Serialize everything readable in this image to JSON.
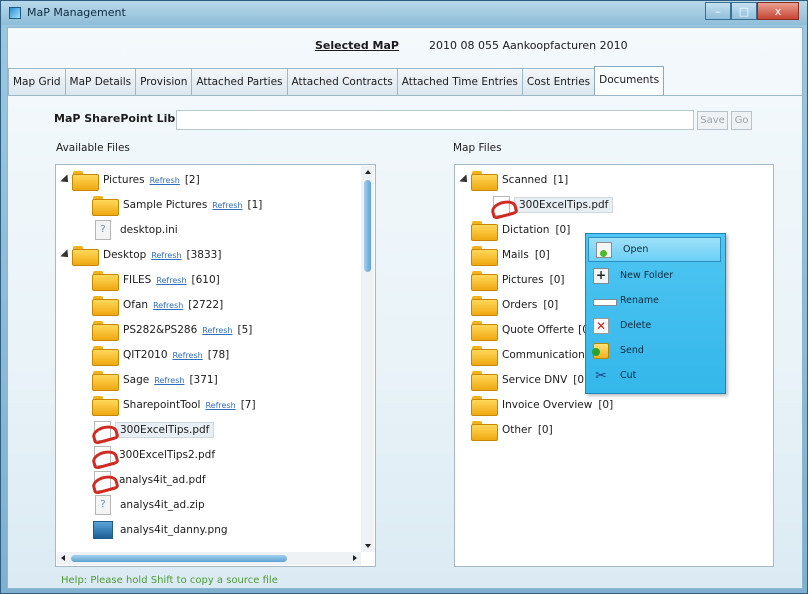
{
  "window": {
    "title": "MaP Management",
    "buttons": {
      "minimize": "–",
      "maximize": "□",
      "close": "x"
    }
  },
  "header": {
    "selected_label": "Selected MaP",
    "selected_value": "2010 08 055 Aankoopfacturen 2010"
  },
  "tabs": [
    {
      "label": "Map Grid"
    },
    {
      "label": "MaP Details"
    },
    {
      "label": "Provision"
    },
    {
      "label": "Attached Parties"
    },
    {
      "label": "Attached Contracts"
    },
    {
      "label": "Attached Time Entries"
    },
    {
      "label": "Cost Entries"
    },
    {
      "label": "Documents"
    }
  ],
  "active_tab": "Documents",
  "library": {
    "label": "MaP SharePoint Library",
    "value": "",
    "save_label": "Save",
    "go_label": "Go"
  },
  "available": {
    "label": "Available Files",
    "refresh_label": "Refresh",
    "rows": [
      {
        "name": "Pictures",
        "count": "[2]",
        "icon": "folder-icon"
      },
      {
        "name": "Sample Pictures",
        "count": "[1]",
        "icon": "folder-icon"
      },
      {
        "name": "desktop.ini",
        "icon": "unknown-file-icon"
      },
      {
        "name": "Desktop",
        "count": "[3833]",
        "icon": "folder-icon"
      },
      {
        "name": "FILES",
        "count": "[610]",
        "icon": "folder-icon"
      },
      {
        "name": "Ofan",
        "count": "[2722]",
        "icon": "folder-icon"
      },
      {
        "name": "PS282&PS286",
        "count": "[5]",
        "icon": "folder-icon"
      },
      {
        "name": "QIT2010",
        "count": "[78]",
        "icon": "folder-icon"
      },
      {
        "name": "Sage",
        "count": "[371]",
        "icon": "folder-icon"
      },
      {
        "name": "SharepointTool",
        "count": "[7]",
        "icon": "folder-icon"
      },
      {
        "name": "300ExcelTips.pdf",
        "icon": "pdf-icon"
      },
      {
        "name": "300ExcelTips2.pdf",
        "icon": "pdf-icon"
      },
      {
        "name": "analys4it_ad.pdf",
        "icon": "pdf-icon"
      },
      {
        "name": "analys4it_ad.zip",
        "icon": "unknown-file-icon"
      },
      {
        "name": "analys4it_danny.png",
        "icon": "image-icon"
      }
    ]
  },
  "mapfiles": {
    "label": "Map Files",
    "rows": [
      {
        "name": "Scanned",
        "count": "[1]",
        "icon": "folder-icon"
      },
      {
        "name": "300ExcelTips.pdf",
        "icon": "pdf-icon"
      },
      {
        "name": "Dictation",
        "count": "[0]",
        "icon": "folder-icon"
      },
      {
        "name": "Mails",
        "count": "[0]",
        "icon": "folder-icon"
      },
      {
        "name": "Pictures",
        "count": "[0]",
        "icon": "folder-icon"
      },
      {
        "name": "Orders",
        "count": "[0]",
        "icon": "folder-icon"
      },
      {
        "name": "Quote Offerte",
        "count": "[0",
        "icon": "folder-icon"
      },
      {
        "name": "Communication",
        "count": "",
        "icon": "folder-icon"
      },
      {
        "name": "Service DNV",
        "count": "[0]",
        "icon": "folder-icon"
      },
      {
        "name": "Invoice Overview",
        "count": "[0]",
        "icon": "folder-icon"
      },
      {
        "name": "Other",
        "count": "[0]",
        "icon": "folder-icon"
      }
    ]
  },
  "context_menu": {
    "items": [
      {
        "label": "Open",
        "icon": "open-icon"
      },
      {
        "label": "New Folder",
        "icon": "new-folder-icon"
      },
      {
        "label": "Rename",
        "icon": "rename-icon"
      },
      {
        "label": "Delete",
        "icon": "delete-icon"
      },
      {
        "label": "Send",
        "icon": "send-icon"
      },
      {
        "label": "Cut",
        "icon": "cut-icon"
      }
    ]
  },
  "help_text": "Help: Please hold Shift to copy a source file"
}
